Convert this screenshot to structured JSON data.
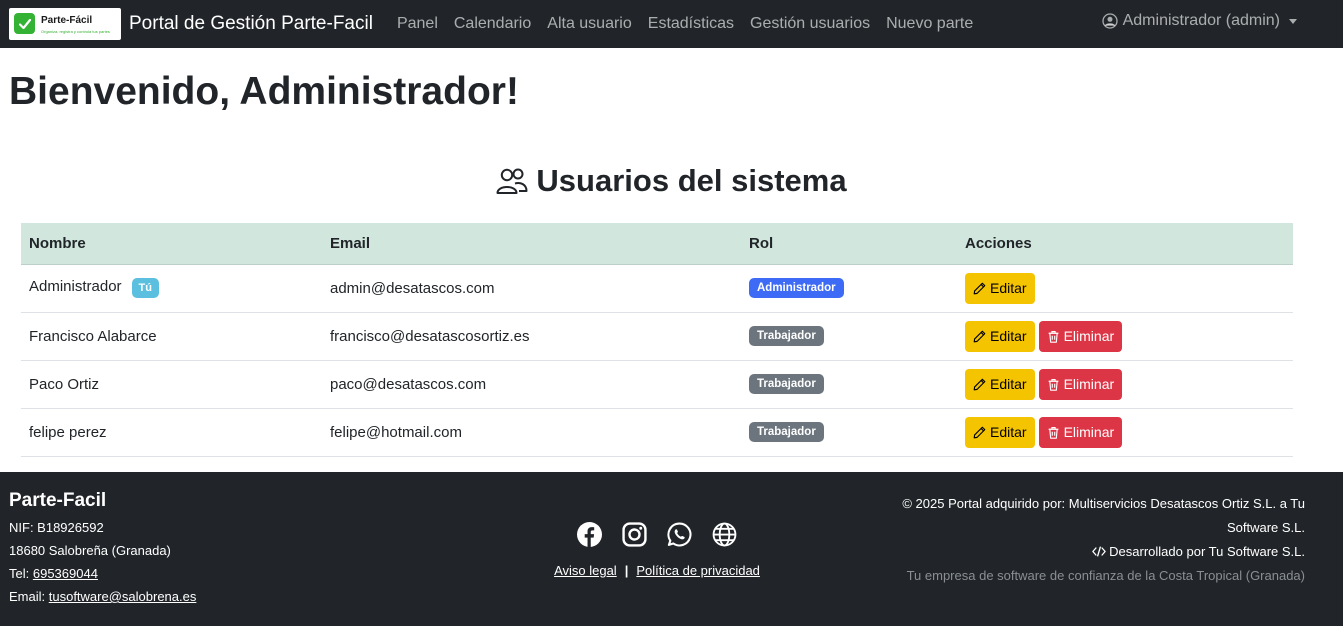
{
  "navbar": {
    "logo_name": "Parte-Fácil",
    "logo_tagline": "Organiza, registra y controla tus partes",
    "brand": "Portal de Gestión Parte-Facil",
    "links": [
      "Panel",
      "Calendario",
      "Alta usuario",
      "Estadísticas",
      "Gestión usuarios",
      "Nuevo parte"
    ],
    "user": "Administrador (admin)"
  },
  "main": {
    "welcome": "Bienvenido, Administrador!",
    "section_title": "Usuarios del sistema",
    "table": {
      "headers": [
        "Nombre",
        "Email",
        "Rol",
        "Acciones"
      ],
      "rows": [
        {
          "name": "Administrador",
          "you_badge": "Tú",
          "email": "admin@desatascos.com",
          "role": "Administrador"
        },
        {
          "name": "Francisco Alabarce",
          "email": "francisco@desatascosortiz.es",
          "role": "Trabajador"
        },
        {
          "name": "Paco Ortiz",
          "email": "paco@desatascos.com",
          "role": "Trabajador"
        },
        {
          "name": "felipe perez",
          "email": "felipe@hotmail.com",
          "role": "Trabajador"
        }
      ],
      "edit_label": "Editar",
      "delete_label": "Eliminar"
    }
  },
  "footer": {
    "brand": "Parte-Facil",
    "nif": "NIF: B18926592",
    "address": "18680 Salobreña (Granada)",
    "tel_label": "Tel:",
    "tel": "695369044",
    "email_label": "Email:",
    "email": "tusoftware@salobrena.es",
    "aviso_legal": "Aviso legal",
    "separator": "|",
    "privacy": "Política de privacidad",
    "copyright": "© 2025 Portal adquirido por: Multiservicios Desatascos Ortiz S.L. a Tu Software S.L.",
    "developed": "Desarrollado por Tu Software S.L.",
    "tagline": "Tu empresa de software de confianza de la Costa Tropical (Granada)"
  },
  "icons": [
    "check-icon",
    "user-circle-icon",
    "users-icon",
    "pencil-icon",
    "trash-icon",
    "facebook-icon",
    "instagram-icon",
    "whatsapp-icon",
    "globe-icon",
    "code-icon"
  ],
  "colors": {
    "navbar_bg": "#212529",
    "table_header_bg": "#d1e7dd",
    "badge_admin": "#3d6bf5",
    "badge_worker": "#6c757d",
    "badge_you": "#5bc0e0",
    "edit_button": "#f5c400",
    "delete_button": "#dc3545"
  }
}
